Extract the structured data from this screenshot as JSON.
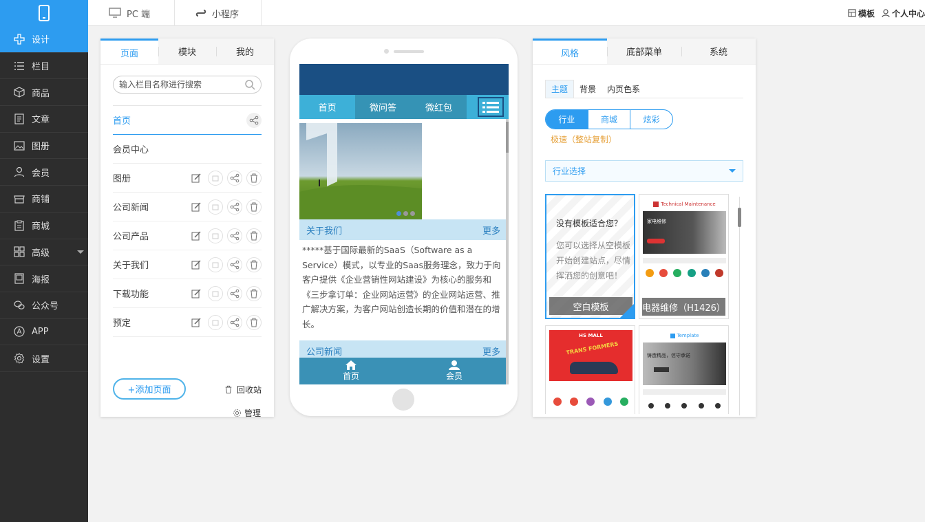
{
  "topbar": {
    "pc_label": "PC 端",
    "mini_label": "小程序",
    "template_label": "模板",
    "user_label": "个人中心"
  },
  "sidebar": {
    "items": [
      {
        "label": "设计",
        "icon": "design-icon"
      },
      {
        "label": "栏目",
        "icon": "list-icon"
      },
      {
        "label": "商品",
        "icon": "box-icon"
      },
      {
        "label": "文章",
        "icon": "article-icon"
      },
      {
        "label": "图册",
        "icon": "image-icon"
      },
      {
        "label": "会员",
        "icon": "user-icon"
      },
      {
        "label": "商铺",
        "icon": "shop-icon"
      },
      {
        "label": "商城",
        "icon": "clipboard-icon"
      },
      {
        "label": "高级",
        "icon": "grid-icon"
      },
      {
        "label": "海报",
        "icon": "poster-icon"
      },
      {
        "label": "公众号",
        "icon": "wechat-icon"
      },
      {
        "label": "APP",
        "icon": "app-icon"
      },
      {
        "label": "设置",
        "icon": "gear-icon"
      }
    ]
  },
  "left_panel": {
    "tabs": [
      "页面",
      "模块",
      "我的"
    ],
    "search_placeholder": "输入栏目名称进行搜索",
    "pages": [
      "首页",
      "会员中心",
      "图册",
      "公司新闻",
      "公司产品",
      "关于我们",
      "下载功能",
      "预定"
    ],
    "add_page": "+添加页面",
    "recycle": "回收站",
    "manage": "管理"
  },
  "phone": {
    "nav": [
      "首页",
      "微问答",
      "微红包"
    ],
    "about_title": "关于我们",
    "more": "更多",
    "about_text": "*****基于国际最新的SaaS（Software as a Service）模式，以专业的Saas服务理念，致力于向客户提供《企业营销性网站建设》为核心的服务和《三步拿订单：企业网站运营》的企业网站运营、推广解决方案，为客户网站创造长期的价值和潜在的增长。",
    "news_title": "公司新闻",
    "footer": [
      "首页",
      "会员"
    ]
  },
  "right_panel": {
    "tabs": [
      "风格",
      "底部菜单",
      "系统"
    ],
    "subtabs": [
      "主题",
      "背景",
      "内页色系"
    ],
    "segments": [
      "行业",
      "商城",
      "炫彩"
    ],
    "fast_copy": "极速（整站复制）",
    "industry_select": "行业选择",
    "blank_question": "没有模板适合您？",
    "blank_text": "您可以选择从空模板开始创建站点，尽情挥洒您的创意吧！",
    "blank_label": "空白模板",
    "template_label": "电器维修（H1426）",
    "thumb_title_1": "Technical Maintenance",
    "thumb_banner_1": "家电维修",
    "thumb_title_2": "HS MALL",
    "thumb_banner_2": "TRANS FORMERS",
    "thumb_title_3": "Template",
    "thumb_banner_3": "铸造精品，信守承诺"
  }
}
